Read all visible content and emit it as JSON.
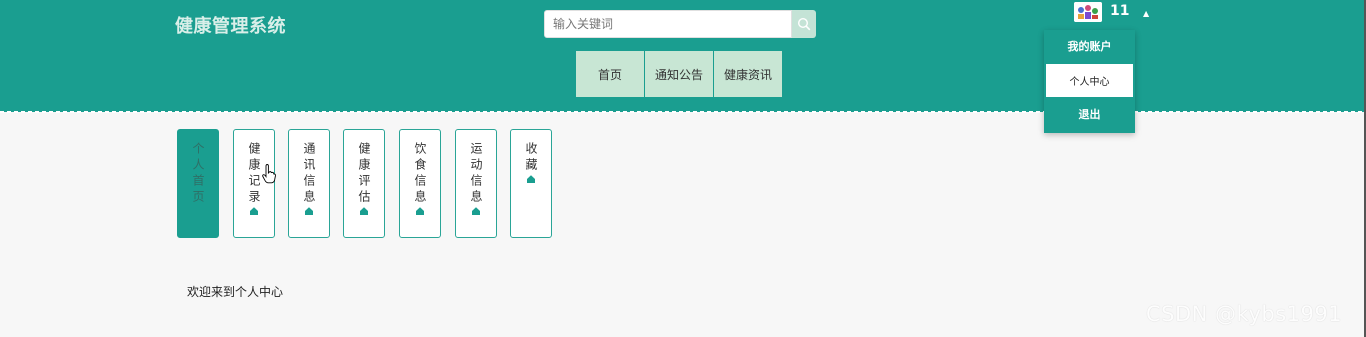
{
  "header": {
    "site_title": "健康管理系统",
    "search": {
      "placeholder": "输入关键词",
      "value": ""
    },
    "nav": [
      "首页",
      "通知公告",
      "健康资讯"
    ]
  },
  "account": {
    "username": "11",
    "dropdown": {
      "title": "我的账户",
      "items": [
        "个人中心",
        "退出"
      ]
    }
  },
  "tabs": [
    {
      "label": "个人首页",
      "active": true
    },
    {
      "label": "健康记录",
      "active": false
    },
    {
      "label": "通讯信息",
      "active": false
    },
    {
      "label": "健康评估",
      "active": false
    },
    {
      "label": "饮食信息",
      "active": false
    },
    {
      "label": "运动信息",
      "active": false
    },
    {
      "label": "收藏",
      "active": false
    }
  ],
  "main": {
    "welcome": "欢迎来到个人中心"
  },
  "watermark": "CSDN @kybs1991",
  "colors": {
    "primary": "#1a9e90",
    "nav_bg": "#c8e6d4",
    "search_btn": "#c4e3d6",
    "page_bg": "#f7f7f7"
  },
  "icons": {
    "search": "search-icon",
    "tab": "house-icon",
    "caret": "caret-up-icon"
  }
}
